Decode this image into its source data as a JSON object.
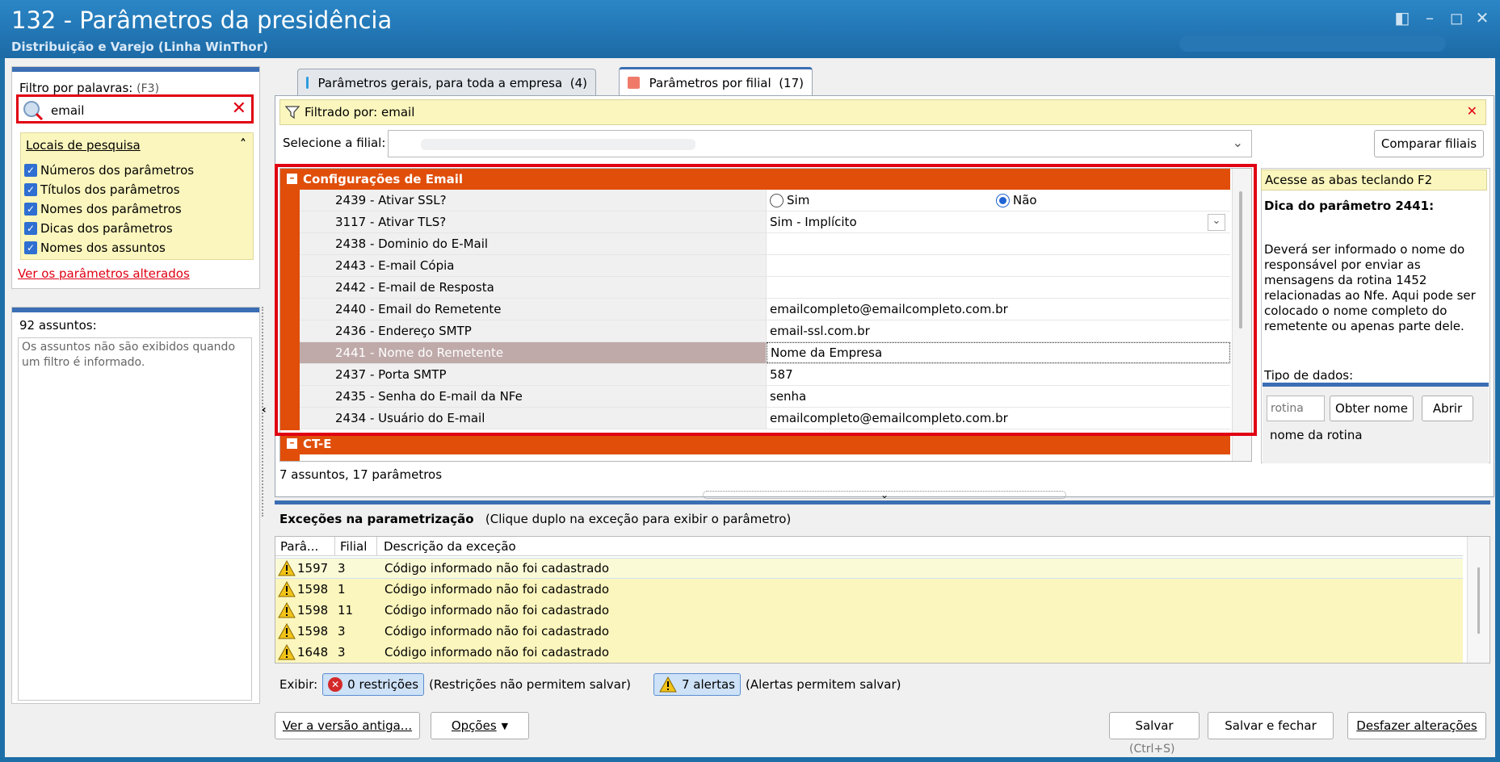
{
  "window": {
    "title": "132 - Parâmetros da presidência",
    "subtitle": "Distribuição e Varejo (Linha WinThor)"
  },
  "left": {
    "filter_label": "Filtro por palavras:",
    "filter_shortcut": "(F3)",
    "search_value": "email",
    "locais_title": "Locais de pesquisa",
    "checkboxes": [
      "Números dos parâmetros",
      "Títulos dos parâmetros",
      "Nomes dos parâmetros",
      "Dicas dos parâmetros",
      "Nomes dos assuntos"
    ],
    "altered_link": "Ver os parâmetros alterados",
    "subjects_count": "92 assuntos:",
    "subjects_note": "Os assuntos não são exibidos quando um filtro é informado."
  },
  "tabs": [
    {
      "label": "Parâmetros gerais, para toda a empresa",
      "count": "(4)"
    },
    {
      "label": "Parâmetros por filial",
      "count": "(17)"
    }
  ],
  "filter": {
    "text": "Filtrado por: email"
  },
  "branch": {
    "label": "Selecione a filial:",
    "compare_button": "Comparar filiais"
  },
  "grid": {
    "group1": "Configurações de Email",
    "group2": "CT-E",
    "radio_sim": "Sim",
    "radio_nao": "Não",
    "rows": [
      {
        "name": "2439 - Ativar SSL?",
        "value": ""
      },
      {
        "name": "3117 - Ativar TLS?",
        "value": "Sim - Implícito"
      },
      {
        "name": "2438 - Dominio do E-Mail",
        "value": ""
      },
      {
        "name": "2443 - E-mail Cópia",
        "value": ""
      },
      {
        "name": "2442 - E-mail de Resposta",
        "value": ""
      },
      {
        "name": "2440 - Email do Remetente",
        "value": "emailcompleto@emailcompleto.com.br"
      },
      {
        "name": "2436 - Endereço SMTP",
        "value": "email-ssl.com.br"
      },
      {
        "name": "2441 - Nome do Remetente",
        "value": "Nome da Empresa"
      },
      {
        "name": "2437 - Porta SMTP",
        "value": "587"
      },
      {
        "name": "2435 - Senha do E-mail da NFe",
        "value": "senha"
      },
      {
        "name": "2434 - Usuário do E-mail",
        "value": "emailcompleto@emailcompleto.com.br"
      }
    ],
    "footer": "7 assuntos, 17 parâmetros"
  },
  "tip": {
    "banner": "Acesse as abas teclando F2",
    "heading": "Dica do parâmetro 2441:",
    "body": "Deverá ser informado o nome do responsável por enviar as mensagens da rotina 1452 relacionadas ao Nfe. Aqui pode ser colocado o nome completo do remetente ou apenas parte dele.",
    "data_type_label": "Tipo de dados:",
    "routine_placeholder": "rotina",
    "get_name_button": "Obter nome",
    "open_button": "Abrir",
    "routine_name": "nome da rotina"
  },
  "exceptions": {
    "title": "Exceções na parametrização",
    "hint": "(Clique duplo na exceção para exibir o parâmetro)",
    "columns": [
      "Parâ...",
      "Filial",
      "Descrição da exceção"
    ],
    "rows": [
      {
        "param": "1597",
        "filial": "3",
        "desc": "Código informado não foi cadastrado"
      },
      {
        "param": "1598",
        "filial": "1",
        "desc": "Código informado não foi cadastrado"
      },
      {
        "param": "1598",
        "filial": "11",
        "desc": "Código informado não foi cadastrado"
      },
      {
        "param": "1598",
        "filial": "3",
        "desc": "Código informado não foi cadastrado"
      },
      {
        "param": "1648",
        "filial": "3",
        "desc": "Código informado não foi cadastrado"
      }
    ],
    "show_label": "Exibir:",
    "restrictions_chip": "0 restrições",
    "restrictions_note": "(Restrições não permitem salvar)",
    "alerts_chip": "7 alertas",
    "alerts_note": "(Alertas permitem salvar)"
  },
  "buttons": {
    "old_version": "Ver a versão antiga...",
    "options": "Opções",
    "save": "Salvar",
    "save_shortcut": "(Ctrl+S)",
    "save_close": "Salvar e fechar",
    "undo": "Desfazer alterações"
  },
  "colors": {
    "accent": "#e04e0a",
    "highlight": "#e00012",
    "note": "#fbf6bd",
    "titlebar": "#1c6aa6"
  }
}
